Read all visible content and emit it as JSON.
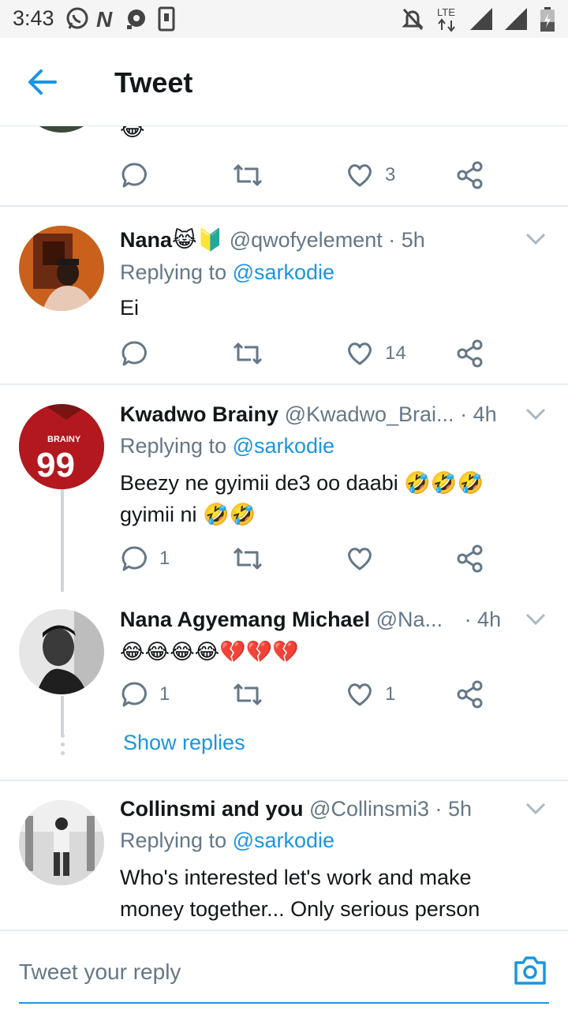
{
  "status_bar": {
    "time": "3:43",
    "network": "LTE"
  },
  "header": {
    "title": "Tweet"
  },
  "top_tweet": {
    "emoji": "😂",
    "like_count": "3"
  },
  "tweets": [
    {
      "name": "Nana😹🔰",
      "handle": "@qwofyelement",
      "time": "· 5h",
      "reply_prefix": "Replying to",
      "reply_mention": "@sarkodie",
      "text": "Ei",
      "reply_count": "",
      "like_count": "14"
    },
    {
      "name": "Kwadwo Brainy",
      "handle": "@Kwadwo_Brai...",
      "time": "· 4h",
      "reply_prefix": "Replying to",
      "reply_mention": "@sarkodie",
      "text_line1": "Beezy ne gyimii de3 oo daabi 🤣🤣🤣",
      "text_line2": "gyimii ni 🤣🤣",
      "reply_count": "1",
      "like_count": ""
    },
    {
      "name": "Nana Agyemang Michael",
      "handle": "@Na...",
      "time": "· 4h",
      "text": "😂😂😂😂💔💔💔",
      "reply_count": "1",
      "like_count": "1",
      "show_replies": "Show replies"
    },
    {
      "name": "Collinsmi and you",
      "handle": "@Collinsmi3",
      "time": "· 5h",
      "reply_prefix": "Replying to",
      "reply_mention": "@sarkodie",
      "text_line1": "Who's interested let's work and make",
      "text_line2": "money together...  Only serious person"
    }
  ],
  "compose": {
    "placeholder": "Tweet your reply"
  },
  "colors": {
    "accent": "#1b95e0",
    "muted": "#657786",
    "divider": "#e6ecf0"
  }
}
